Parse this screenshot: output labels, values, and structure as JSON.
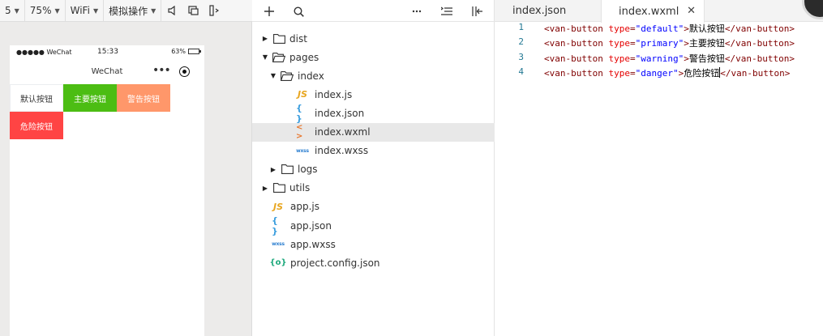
{
  "simulator": {
    "toolbar": {
      "zoom_partial": "5",
      "zoom_percent": "75%",
      "network": "WiFi",
      "simulate_ops": "模拟操作"
    },
    "status_bar": {
      "carrier": "●●●●● WeChat",
      "time": "15:33",
      "battery": "63%",
      "battery_level": 0.63
    },
    "nav_title": "WeChat",
    "nav_more": "•••",
    "buttons": [
      {
        "label": "默认按钮",
        "type": "default",
        "color": "#ffffff"
      },
      {
        "label": "主要按钮",
        "type": "primary",
        "color": "#4cbd13"
      },
      {
        "label": "警告按钮",
        "type": "warning",
        "color": "#ff976a"
      },
      {
        "label": "危险按钮",
        "type": "danger",
        "color": "#ff4444"
      }
    ]
  },
  "explorer": {
    "tools": [
      "add-icon",
      "search-icon",
      "more-icon",
      "collapse-icon",
      "split-icon"
    ],
    "tree": [
      {
        "label": "dist",
        "kind": "folder",
        "expanded": false
      },
      {
        "label": "pages",
        "kind": "folder",
        "expanded": true
      },
      {
        "label": "index",
        "kind": "folder",
        "expanded": true
      },
      {
        "label": "index.js",
        "kind": "js"
      },
      {
        "label": "index.json",
        "kind": "json"
      },
      {
        "label": "index.wxml",
        "kind": "wxml",
        "selected": true
      },
      {
        "label": "index.wxss",
        "kind": "wxss"
      },
      {
        "label": "logs",
        "kind": "folder",
        "expanded": false
      },
      {
        "label": "utils",
        "kind": "folder",
        "expanded": false
      },
      {
        "label": "app.js",
        "kind": "js"
      },
      {
        "label": "app.json",
        "kind": "json"
      },
      {
        "label": "app.wxss",
        "kind": "wxss"
      },
      {
        "label": "project.config.json",
        "kind": "config"
      }
    ],
    "icons": {
      "js": "JS",
      "json": "{ }",
      "wxml": "< >",
      "wxss": "wxss",
      "config": "{o}"
    }
  },
  "editor": {
    "tabs": [
      {
        "label": "index.json",
        "active": false
      },
      {
        "label": "index.wxml",
        "active": true,
        "close": "✕"
      }
    ],
    "lines": [
      {
        "no": "1",
        "tag": "<van-button",
        "attr": "type",
        "value": "\"default\"",
        "text": "默认按钮",
        "close": "</van-button>"
      },
      {
        "no": "2",
        "tag": "<van-button",
        "attr": "type",
        "value": "\"primary\"",
        "text": "主要按钮",
        "close": "</van-button>"
      },
      {
        "no": "3",
        "tag": "<van-button",
        "attr": "type",
        "value": "\"warning\"",
        "text": "警告按钮",
        "close": "</van-button>"
      },
      {
        "no": "4",
        "tag": "<van-button",
        "attr": "type",
        "value": "\"danger\"",
        "text": "危险按钮",
        "close": "</van-button>"
      }
    ]
  }
}
